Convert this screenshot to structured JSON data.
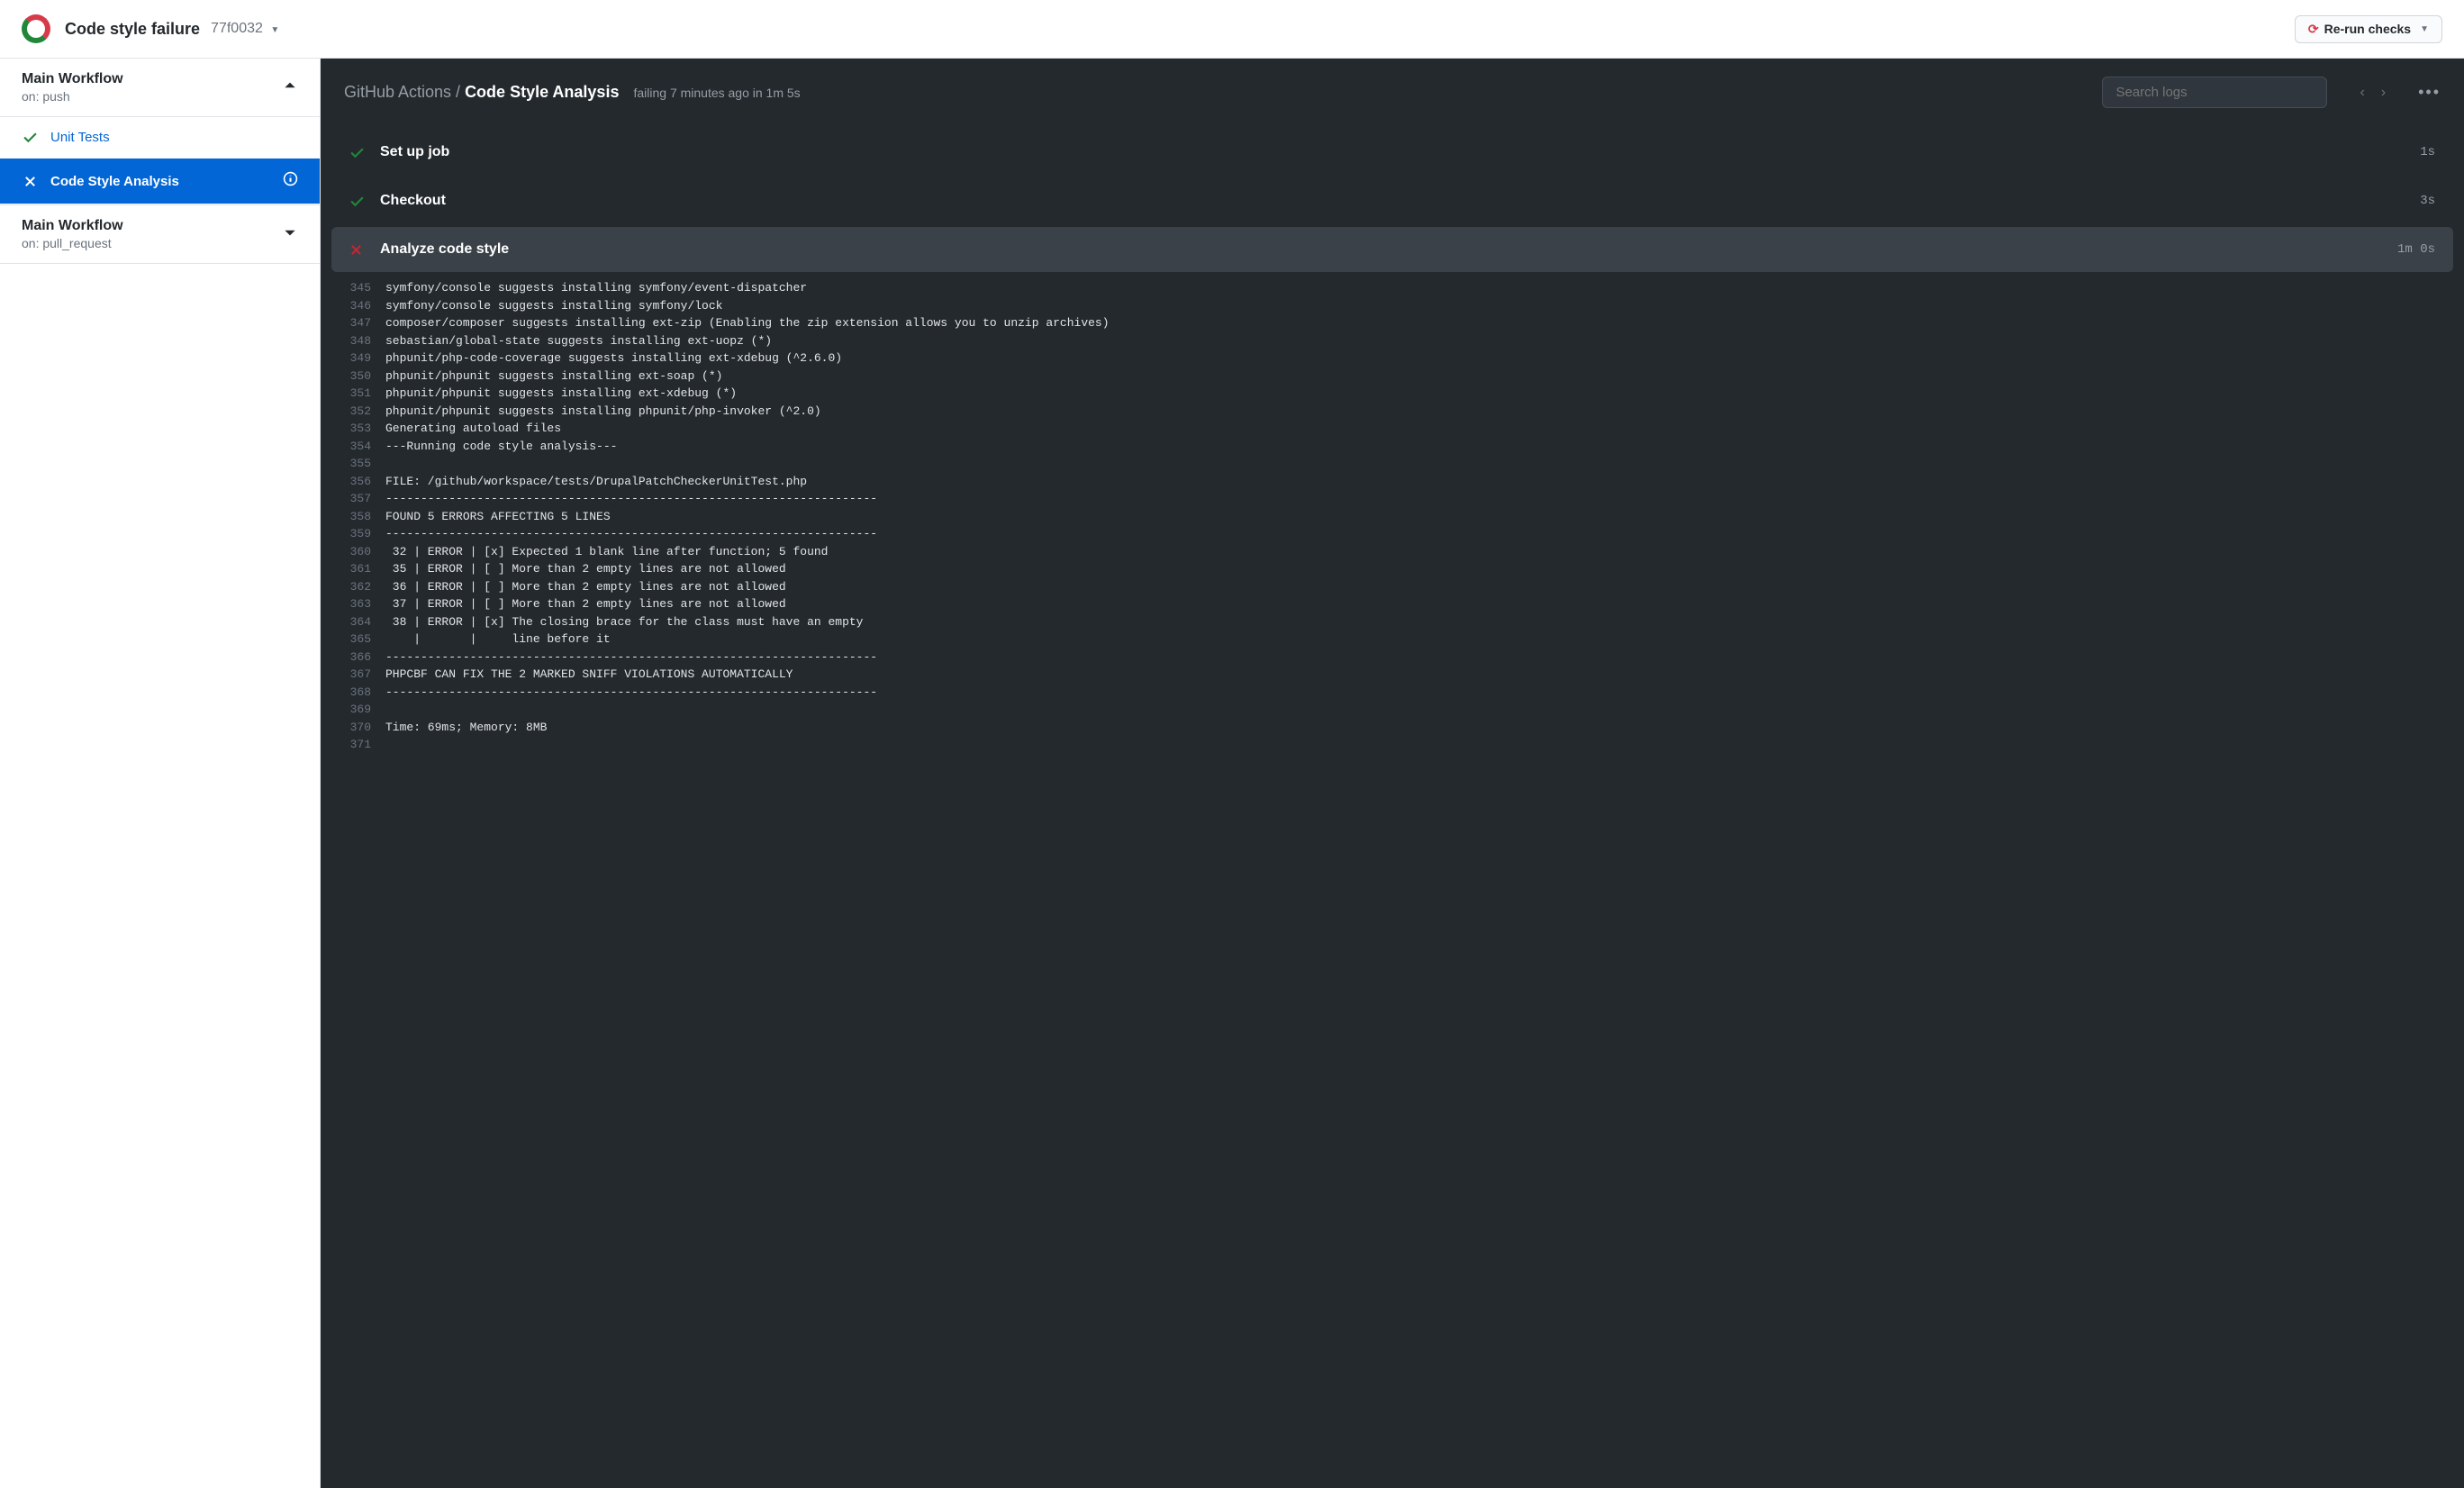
{
  "header": {
    "title": "Code style failure",
    "commit_sha": "77f0032",
    "rerun_label": "Re-run checks"
  },
  "sidebar": {
    "workflows": [
      {
        "name": "Main Workflow",
        "trigger": "on: push",
        "expanded": true,
        "jobs": [
          {
            "id": "unit-tests",
            "name": "Unit Tests",
            "status": "success",
            "active": false
          },
          {
            "id": "code-style",
            "name": "Code Style Analysis",
            "status": "fail",
            "active": true
          }
        ]
      },
      {
        "name": "Main Workflow",
        "trigger": "on: pull_request",
        "expanded": false,
        "jobs": []
      }
    ]
  },
  "content": {
    "breadcrumb_prefix": "GitHub Actions / ",
    "breadcrumb_current": "Code Style Analysis",
    "status": "failing 7 minutes ago in 1m 5s",
    "search_placeholder": "Search logs",
    "steps": [
      {
        "name": "Set up job",
        "status": "success",
        "duration": "1s",
        "expanded": false
      },
      {
        "name": "Checkout",
        "status": "success",
        "duration": "3s",
        "expanded": false
      },
      {
        "name": "Analyze code style",
        "status": "fail",
        "duration": "1m 0s",
        "expanded": true
      }
    ],
    "log_lines": [
      {
        "n": "345",
        "t": "symfony/console suggests installing symfony/event-dispatcher"
      },
      {
        "n": "346",
        "t": "symfony/console suggests installing symfony/lock"
      },
      {
        "n": "347",
        "t": "composer/composer suggests installing ext-zip (Enabling the zip extension allows you to unzip archives)"
      },
      {
        "n": "348",
        "t": "sebastian/global-state suggests installing ext-uopz (*)"
      },
      {
        "n": "349",
        "t": "phpunit/php-code-coverage suggests installing ext-xdebug (^2.6.0)"
      },
      {
        "n": "350",
        "t": "phpunit/phpunit suggests installing ext-soap (*)"
      },
      {
        "n": "351",
        "t": "phpunit/phpunit suggests installing ext-xdebug (*)"
      },
      {
        "n": "352",
        "t": "phpunit/phpunit suggests installing phpunit/php-invoker (^2.0)"
      },
      {
        "n": "353",
        "t": "Generating autoload files"
      },
      {
        "n": "354",
        "t": "---Running code style analysis---"
      },
      {
        "n": "355",
        "t": ""
      },
      {
        "n": "356",
        "t": "FILE: /github/workspace/tests/DrupalPatchCheckerUnitTest.php"
      },
      {
        "n": "357",
        "t": "----------------------------------------------------------------------"
      },
      {
        "n": "358",
        "t": "FOUND 5 ERRORS AFFECTING 5 LINES"
      },
      {
        "n": "359",
        "t": "----------------------------------------------------------------------"
      },
      {
        "n": "360",
        "t": " 32 | ERROR | [x] Expected 1 blank line after function; 5 found"
      },
      {
        "n": "361",
        "t": " 35 | ERROR | [ ] More than 2 empty lines are not allowed"
      },
      {
        "n": "362",
        "t": " 36 | ERROR | [ ] More than 2 empty lines are not allowed"
      },
      {
        "n": "363",
        "t": " 37 | ERROR | [ ] More than 2 empty lines are not allowed"
      },
      {
        "n": "364",
        "t": " 38 | ERROR | [x] The closing brace for the class must have an empty"
      },
      {
        "n": "365",
        "t": "    |       |     line before it"
      },
      {
        "n": "366",
        "t": "----------------------------------------------------------------------"
      },
      {
        "n": "367",
        "t": "PHPCBF CAN FIX THE 2 MARKED SNIFF VIOLATIONS AUTOMATICALLY"
      },
      {
        "n": "368",
        "t": "----------------------------------------------------------------------"
      },
      {
        "n": "369",
        "t": ""
      },
      {
        "n": "370",
        "t": "Time: 69ms; Memory: 8MB"
      },
      {
        "n": "371",
        "t": ""
      }
    ]
  }
}
